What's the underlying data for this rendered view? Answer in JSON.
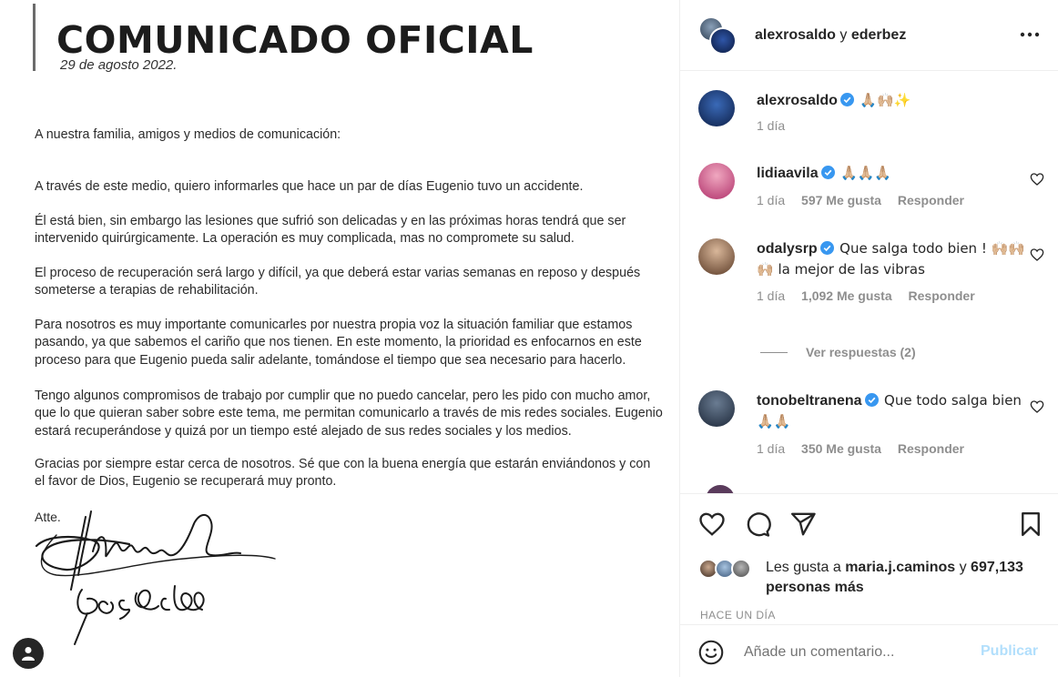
{
  "letter": {
    "title": "COMUNICADO OFICIAL",
    "date": "29 de agosto 2022.",
    "greeting": "A nuestra familia, amigos y medios de comunicación:",
    "paragraphs": [
      "A través de este medio, quiero informarles que hace un par de días Eugenio tuvo un accidente.",
      "Él está bien, sin embargo las lesiones que sufrió son delicadas y en las próximas horas tendrá que ser intervenido quirúrgicamente. La operación es muy complicada, mas no compromete su salud.",
      "El proceso de recuperación será largo y difícil, ya que deberá estar varias semanas en reposo y después someterse a terapias de rehabilitación.",
      "Para nosotros es muy importante comunicarles por nuestra propia voz la situación familiar que estamos pasando, ya que sabemos el cariño que nos tienen. En este momento, la prioridad es enfocarnos en este proceso para que Eugenio pueda salir adelante, tomándose el tiempo que sea necesario para hacerlo.",
      "Tengo algunos compromisos de trabajo por cumplir que no puedo cancelar, pero les pido con mucho amor, que lo que quieran saber sobre este tema, me permitan comunicarlo a través de mis redes sociales. Eugenio estará recuperándose y quizá por un tiempo esté alejado de sus redes sociales y los medios.",
      "Gracias por siempre estar cerca de nosotros. Sé que con la buena energía que estarán enviándonos y con el favor de Dios, Eugenio se recuperará muy pronto."
    ],
    "closing": "Atte.",
    "signature_text": "Alessandra Rosaldo"
  },
  "header": {
    "user1": "alexrosaldo",
    "connector": "y",
    "user2": "ederbez",
    "more_icon": "more-horizontal-icon"
  },
  "comments": [
    {
      "user": "alexrosaldo",
      "verified": true,
      "text": "🙏🏼🙌🏼✨",
      "time": "1 día",
      "likes": "",
      "reply": ""
    },
    {
      "user": "lidiaavila",
      "verified": true,
      "text": "🙏🏼🙏🏼🙏🏼",
      "time": "1 día",
      "likes": "597 Me gusta",
      "reply": "Responder"
    },
    {
      "user": "odalysrp",
      "verified": true,
      "text": "Que salga todo bien ! 🙌🏼🙌🏼🙌🏼 la mejor de las vibras",
      "time": "1 día",
      "likes": "1,092 Me gusta",
      "reply": "Responder"
    },
    {
      "user": "tonobeltranena",
      "verified": true,
      "text": "Que todo salga bien 🙏🏼🙏🏼",
      "time": "1 día",
      "likes": "350 Me gusta",
      "reply": "Responder"
    }
  ],
  "view_replies": "Ver respuestas (2)",
  "actions": {
    "icons": [
      "heart-icon",
      "comment-icon",
      "share-icon",
      "bookmark-icon"
    ]
  },
  "likes": {
    "prefix": "Les gusta a",
    "user": "maria.j.caminos",
    "connector": "y",
    "others": "697,133 personas más"
  },
  "timestamp": "HACE UN DÍA",
  "composer": {
    "placeholder": "Añade un comentario...",
    "publish": "Publicar"
  },
  "colors": {
    "verified": "#3897f0",
    "publish_disabled": "#b2dffc",
    "meta": "#8e8e8e"
  }
}
